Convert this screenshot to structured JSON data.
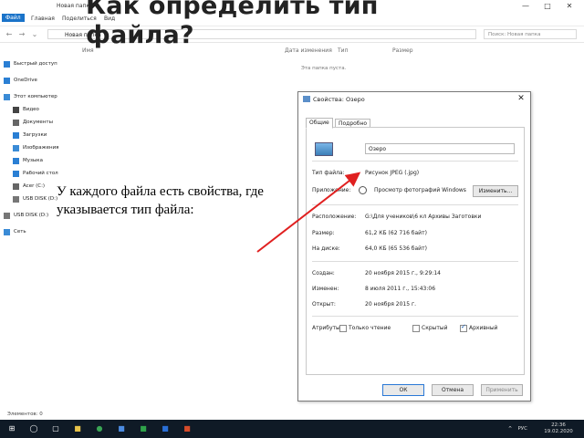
{
  "slide": {
    "title": "Как определить тип файла?",
    "caption": "У каждого файла есть свойства, где указывается тип файла:"
  },
  "explorer": {
    "window_title": "Новая папка",
    "ribbon_tabs": [
      "Файл",
      "Главная",
      "Поделиться",
      "Вид"
    ],
    "address": "Новая папка",
    "search_placeholder": "Поиск: Новая папка",
    "columns": [
      "Имя",
      "Дата изменения",
      "Тип",
      "Размер"
    ],
    "empty_message": "Эта папка пуста.",
    "sidebar": [
      {
        "label": "Быстрый доступ",
        "icon": "star-icon",
        "color": "#2a7fd4"
      },
      {
        "label": "OneDrive",
        "icon": "cloud-icon",
        "color": "#2a7fd4"
      },
      {
        "label": "Этот компьютер",
        "icon": "computer-icon",
        "color": "#3a8bd6"
      },
      {
        "label": "Видео",
        "icon": "video-icon",
        "color": "#444"
      },
      {
        "label": "Документы",
        "icon": "document-icon",
        "color": "#666"
      },
      {
        "label": "Загрузки",
        "icon": "download-icon",
        "color": "#2a7fd4"
      },
      {
        "label": "Изображения",
        "icon": "image-icon",
        "color": "#3a8bd6"
      },
      {
        "label": "Музыка",
        "icon": "music-icon",
        "color": "#2a7fd4"
      },
      {
        "label": "Рабочий стол",
        "icon": "desktop-icon",
        "color": "#2a7fd4"
      },
      {
        "label": "Acer (C:)",
        "icon": "drive-icon",
        "color": "#666"
      },
      {
        "label": "USB DISK (D:)",
        "icon": "usb-drive-icon",
        "color": "#777"
      },
      {
        "label": "USB DISK (D:)",
        "icon": "usb-drive-icon",
        "color": "#777"
      },
      {
        "label": "Сеть",
        "icon": "network-icon",
        "color": "#3a8bd6"
      }
    ],
    "status": "Элементов: 0"
  },
  "dialog": {
    "title": "Свойства: Озеро",
    "tabs": [
      "Общие",
      "Подробно"
    ],
    "file_name": "Озеро",
    "rows_type": [
      {
        "label": "Тип файла:",
        "value": "Рисунок JPEG (.jpg)"
      },
      {
        "label": "Приложение:",
        "value": "Просмотр фотографий Windows"
      }
    ],
    "change_button": "Изменить...",
    "rows_loc": [
      {
        "label": "Расположение:",
        "value": "G:\\Для учеников\\6 кл Архивы Заготовки"
      },
      {
        "label": "Размер:",
        "value": "61,2 КБ (62 716 байт)"
      },
      {
        "label": "На диске:",
        "value": "64,0 КБ (65 536 байт)"
      }
    ],
    "rows_dates": [
      {
        "label": "Создан:",
        "value": "20 ноября 2015 г., 9:29:14"
      },
      {
        "label": "Изменен:",
        "value": "8 июля 2011 г., 15:43:06"
      },
      {
        "label": "Открыт:",
        "value": "20 ноября 2015 г."
      }
    ],
    "attributes_label": "Атрибуты:",
    "attributes": [
      {
        "label": "Только чтение",
        "checked": false
      },
      {
        "label": "Скрытый",
        "checked": false
      },
      {
        "label": "Архивный",
        "checked": true
      }
    ],
    "buttons": {
      "ok": "ОК",
      "cancel": "Отмена",
      "apply": "Применить"
    }
  },
  "taskbar": {
    "lang": "РУС",
    "time": "22:36",
    "date": "19.02.2020"
  },
  "colors": {
    "accent": "#1a73c9",
    "arrow": "#e02020",
    "taskbar": "#0f1a26"
  }
}
